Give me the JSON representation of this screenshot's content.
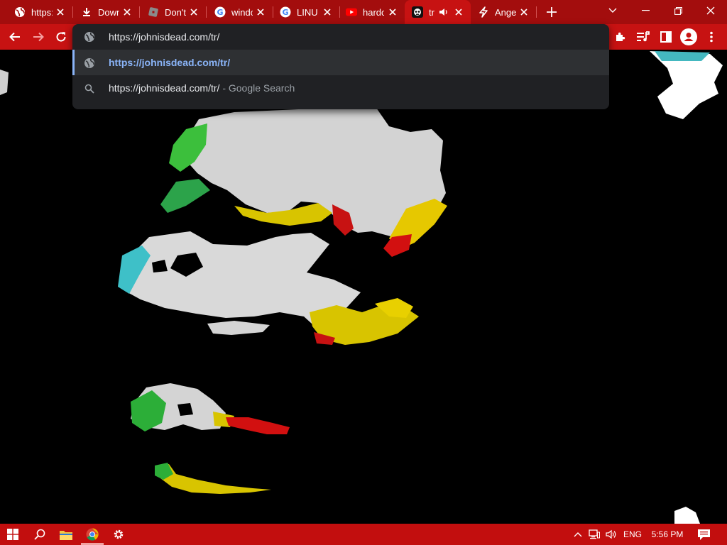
{
  "tabs": [
    {
      "title": "https://",
      "icon": "globe-icon"
    },
    {
      "title": "Downloads",
      "icon": "download-icon"
    },
    {
      "title": "Don't",
      "icon": "roblox-icon"
    },
    {
      "title": "window",
      "icon": "google-icon"
    },
    {
      "title": "LINUX",
      "icon": "google-icon"
    },
    {
      "title": "hardcore",
      "icon": "youtube-icon"
    },
    {
      "title": "tr",
      "icon": "skull-icon",
      "active": true,
      "audio": true
    },
    {
      "title": "Angel",
      "icon": "bolt-icon"
    }
  ],
  "omnibox": {
    "input_value": "https://johnisdead.com/tr/",
    "suggestions": [
      {
        "text": "https://johnisdead.com/tr/",
        "icon": "globe-icon",
        "selected": true
      },
      {
        "text": "https://johnisdead.com/tr/",
        "suffix": "- Google Search",
        "icon": "search-icon"
      }
    ]
  },
  "taskbar": {
    "language": "ENG",
    "time": "5:56 PM"
  },
  "colors": {
    "tabstrip": "#a30d0d",
    "toolbar": "#c71212",
    "omnibox_bg": "#202124",
    "link": "#8ab4f8",
    "taskbar": "#c20e0e"
  }
}
